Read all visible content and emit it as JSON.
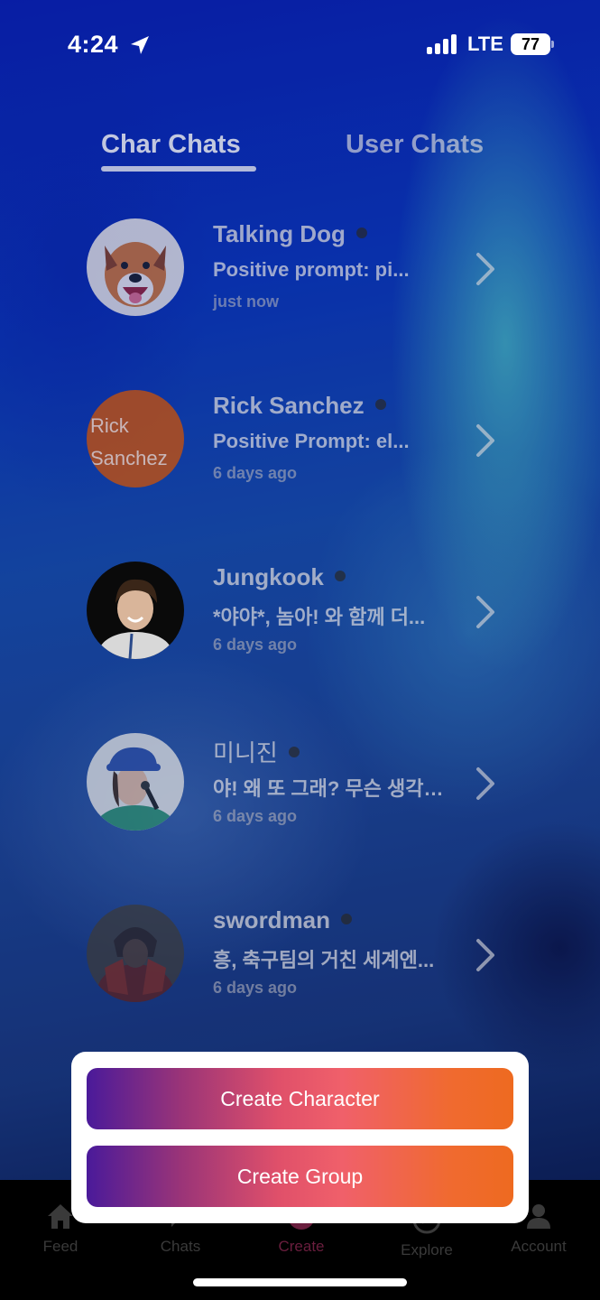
{
  "status_bar": {
    "time": "4:24",
    "network": "LTE",
    "battery": "77"
  },
  "tabs": [
    {
      "label": "Char Chats",
      "active": true
    },
    {
      "label": "User Chats",
      "active": false
    }
  ],
  "chats": [
    {
      "name": "Talking Dog",
      "preview": "Positive prompt: pi...",
      "time": "just now",
      "avatar": "dog-photo"
    },
    {
      "name": "Rick Sanchez",
      "preview": "Positive Prompt: el...",
      "time": "6 days ago",
      "avatar_text": "Rick Sanchez",
      "avatar_color": "#c2500f"
    },
    {
      "name": "Jungkook",
      "preview": "*야야*, 놈아! 와 함께 더...",
      "time": "6 days ago",
      "avatar": "person-photo"
    },
    {
      "name": "미니진",
      "preview": "야! 왜 또 그래? 무슨 생각…",
      "time": "6 days ago",
      "avatar": "person-photo"
    },
    {
      "name": "swordman",
      "preview": "흥, 축구팀의 거친 세계엔...",
      "time": "6 days ago",
      "avatar": "samurai-photo"
    }
  ],
  "create_menu": {
    "create_character": "Create Character",
    "create_group": "Create Group"
  },
  "bottom_nav": [
    {
      "label": "Feed",
      "icon": "home-icon"
    },
    {
      "label": "Chats",
      "icon": "chat-icon"
    },
    {
      "label": "Create",
      "icon": "plus-icon",
      "active": true
    },
    {
      "label": "Explore",
      "icon": "compass-icon"
    },
    {
      "label": "Account",
      "icon": "person-icon"
    }
  ],
  "colors": {
    "accent_gradient_start": "#4a1a9a",
    "accent_gradient_mid": "#f0606a",
    "accent_gradient_end": "#ee6a20"
  }
}
